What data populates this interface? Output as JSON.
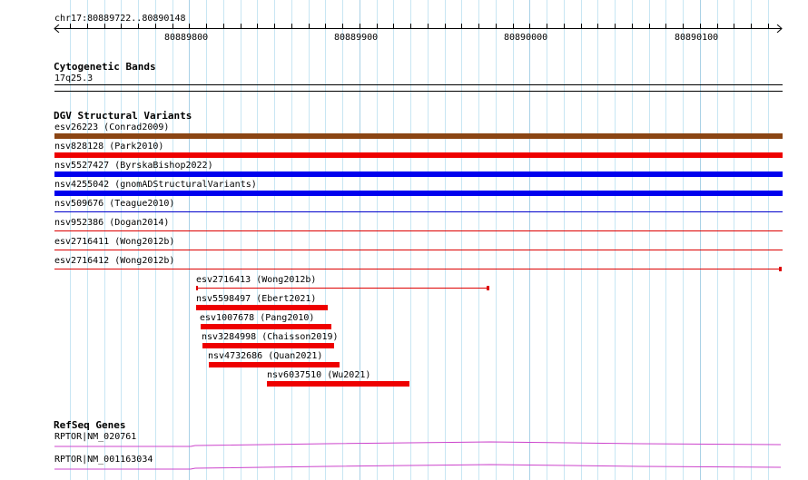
{
  "ruler": {
    "range_label": "chr17:80889722..80890148",
    "ticks": [
      "80889800",
      "80889900",
      "80890000",
      "80890100"
    ]
  },
  "cytoband": {
    "title": "Cytogenetic Bands",
    "band": "17q25.3"
  },
  "dgv": {
    "title": "DGV Structural Variants",
    "features": [
      {
        "label": "esv26223 (Conrad2009)",
        "color": "#8b4513",
        "style": "thick"
      },
      {
        "label": "nsv828128 (Park2010)",
        "color": "#ee0000",
        "style": "thick"
      },
      {
        "label": "nsv5527427 (ByrskaBishop2022)",
        "color": "#0000ee",
        "style": "thick"
      },
      {
        "label": "nsv4255042 (gnomADStructuralVariants)",
        "color": "#0000ee",
        "style": "thick"
      },
      {
        "label": "nsv509676 (Teague2010)",
        "color": "#0000cc",
        "style": "thin"
      },
      {
        "label": "nsv952386 (Dogan2014)",
        "color": "#dd0000",
        "style": "thin"
      },
      {
        "label": "esv2716411 (Wong2012b)",
        "color": "#dd0000",
        "style": "thin"
      },
      {
        "label": "esv2716412 (Wong2012b)",
        "color": "#dd0000",
        "style": "thin-end"
      },
      {
        "label": "esv2716413 (Wong2012b)",
        "color": "#dd0000",
        "style": "thin-ends"
      },
      {
        "label": "nsv5598497 (Ebert2021)",
        "color": "#ee0000",
        "style": "thick"
      },
      {
        "label": "esv1007678 (Pang2010)",
        "color": "#ee0000",
        "style": "thick"
      },
      {
        "label": "nsv3284998 (Chaisson2019)",
        "color": "#ee0000",
        "style": "thick"
      },
      {
        "label": "nsv4732686 (Quan2021)",
        "color": "#ee0000",
        "style": "thick"
      },
      {
        "label": "nsv6037510 (Wu2021)",
        "color": "#ee0000",
        "style": "thick"
      }
    ]
  },
  "refseq": {
    "title": "RefSeq Genes",
    "transcripts": [
      {
        "label": "RPTOR|NM_020761",
        "color": "#cc44cc"
      },
      {
        "label": "RPTOR|NM_001163034",
        "color": "#cc44cc"
      }
    ]
  }
}
